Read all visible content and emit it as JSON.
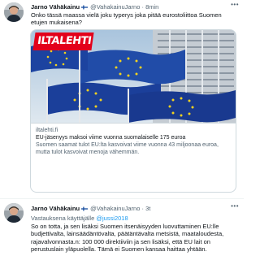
{
  "tweets": [
    {
      "author_name": "Jarno Vähäkainu",
      "handle": "@VahakainuJarno",
      "separator": "·",
      "time": "8min",
      "text": "Onko tässä maassa vielä joku typerys joka pitää eurostoliittoa Suomen etujen mukaisena?",
      "card": {
        "logo": "ILTALEHTI",
        "domain": "iltalehti.fi",
        "title": "EU-jäsenyys maksoi viime vuonna suomalaiselle 175 euroa",
        "description": "Suomen saamat tulot EU:lta kasvoivat viime vuonna 43 miljoonaa euroa, mutta tulot kasvoivat menoja vähemmän."
      }
    },
    {
      "author_name": "Jarno Vähäkainu",
      "handle": "@VahakainuJarno",
      "separator": "·",
      "time": "3t",
      "reply_prefix": "Vastauksena käyttäjälle",
      "reply_to": "@jussi2018",
      "text": "So on totta, ja sen lisäksi Suomen itsenäisyyden luovuttaminen EU:lle budjettivalta, lainsäädäntövalta, päätäntävalta metsistä, maataloudesta, rajavalvonnasta.n: 100 000 direktiiviin ja sen lisäksi, että EU lait on perustuslain yläpuolella. Tämä ei Suomen kansaa haittaa yhtään."
    }
  ],
  "icons": {
    "more": "more-horizontal-icon",
    "flag": "finland-flag-icon"
  }
}
